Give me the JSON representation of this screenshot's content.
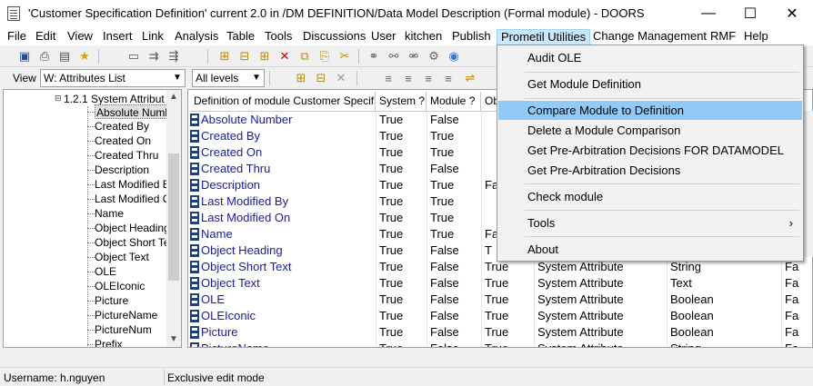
{
  "window": {
    "title": "'Customer Specification Definition' current 2.0 in /DM DEFINITION/Data Model Description (Formal module) - DOORS",
    "minimize": "—",
    "maximize": "☐",
    "close": "✕"
  },
  "menu": {
    "items": [
      {
        "label": "File"
      },
      {
        "label": "Edit"
      },
      {
        "label": "View"
      },
      {
        "label": "Insert"
      },
      {
        "label": "Link"
      },
      {
        "label": "Analysis"
      },
      {
        "label": "Table"
      },
      {
        "label": "Tools"
      },
      {
        "label": "Discussions"
      },
      {
        "label": "User"
      },
      {
        "label": "kitchen"
      },
      {
        "label": "Publish"
      },
      {
        "label": "Prometil Utilities"
      },
      {
        "label": "Change Management"
      },
      {
        "label": "RMF"
      },
      {
        "label": "Help"
      }
    ]
  },
  "toolbar2": {
    "view_label": "View",
    "view_value": "W: Attributes List",
    "levels_value": "All levels"
  },
  "tree": {
    "parent": "1.2.1 System Attribut",
    "items": [
      "Absolute Numbe",
      "Created By",
      "Created On",
      "Created Thru",
      "Description",
      "Last Modified By",
      "Last Modified On",
      "Name",
      "Object Heading",
      "Object Short Tex",
      "Object Text",
      "OLE",
      "OLEIconic",
      "Picture",
      "PictureName",
      "PictureNum",
      "Prefix"
    ]
  },
  "grid": {
    "headers": [
      "Definition of module Customer Specificatio",
      "System ?",
      "Module ?",
      "Ob"
    ],
    "rows": [
      {
        "name": "Absolute Number",
        "system": "True",
        "module": "False",
        "ob": "",
        "type": "",
        "base": "",
        "last": ""
      },
      {
        "name": "Created By",
        "system": "True",
        "module": "True",
        "ob": "",
        "type": "",
        "base": "",
        "last": ""
      },
      {
        "name": "Created On",
        "system": "True",
        "module": "True",
        "ob": "",
        "type": "",
        "base": "",
        "last": ""
      },
      {
        "name": "Created Thru",
        "system": "True",
        "module": "False",
        "ob": "",
        "type": "",
        "base": "",
        "last": ""
      },
      {
        "name": "Description",
        "system": "True",
        "module": "True",
        "ob": "Fa",
        "type": "",
        "base": "",
        "last": ""
      },
      {
        "name": "Last Modified By",
        "system": "True",
        "module": "True",
        "ob": "",
        "type": "",
        "base": "",
        "last": ""
      },
      {
        "name": "Last Modified On",
        "system": "True",
        "module": "True",
        "ob": "",
        "type": "",
        "base": "",
        "last": ""
      },
      {
        "name": "Name",
        "system": "True",
        "module": "True",
        "ob": "Fa",
        "type": "",
        "base": "",
        "last": ""
      },
      {
        "name": "Object Heading",
        "system": "True",
        "module": "False",
        "ob": "T",
        "type": "",
        "base": "",
        "last": ""
      },
      {
        "name": "Object Short Text",
        "system": "True",
        "module": "False",
        "ob": "True",
        "type": "System Attribute",
        "base": "String",
        "last": "Fa"
      },
      {
        "name": "Object Text",
        "system": "True",
        "module": "False",
        "ob": "True",
        "type": "System Attribute",
        "base": "Text",
        "last": "Fa"
      },
      {
        "name": "OLE",
        "system": "True",
        "module": "False",
        "ob": "True",
        "type": "System Attribute",
        "base": "Boolean",
        "last": "Fa"
      },
      {
        "name": "OLEIconic",
        "system": "True",
        "module": "False",
        "ob": "True",
        "type": "System Attribute",
        "base": "Boolean",
        "last": "Fa"
      },
      {
        "name": "Picture",
        "system": "True",
        "module": "False",
        "ob": "True",
        "type": "System Attribute",
        "base": "Boolean",
        "last": "Fa"
      },
      {
        "name": "PictureName",
        "system": "True",
        "module": "False",
        "ob": "True",
        "type": "System Attribute",
        "base": "String",
        "last": "Fa"
      }
    ]
  },
  "dropdown": {
    "items": [
      {
        "label": "Audit OLE"
      },
      {
        "label": "Get Module Definition"
      },
      {
        "label": "Compare Module to Definition"
      },
      {
        "label": "Delete a Module Comparison"
      },
      {
        "label": "Get Pre-Arbitration Decisions FOR DATAMODEL"
      },
      {
        "label": "Get Pre-Arbitration Decisions"
      },
      {
        "label": "Check module"
      },
      {
        "label": "Tools"
      },
      {
        "label": "About"
      }
    ],
    "submenu_arrow": "›"
  },
  "status": {
    "username": "Username: h.nguyen",
    "mode": "Exclusive edit mode"
  }
}
